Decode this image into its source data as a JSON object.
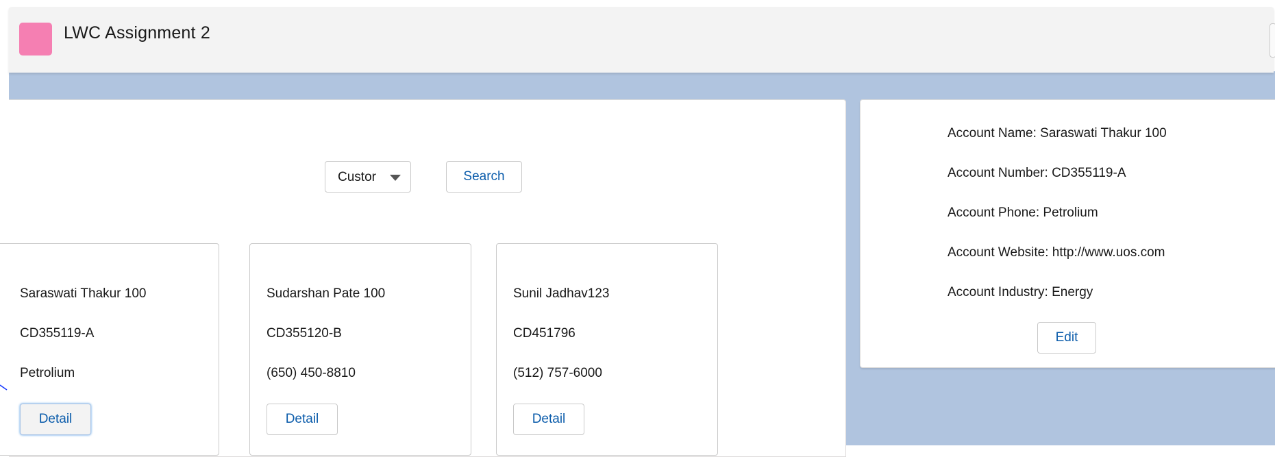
{
  "app": {
    "title": "LWC Assignment 2",
    "icon_name": "app-icon",
    "icon_color": "#f57fb2"
  },
  "search": {
    "picklist_value": "Custor",
    "search_label": "Search"
  },
  "accounts": [
    {
      "name": "Saraswati Thakur 100",
      "number": "CD355119-A",
      "phone": "Petrolium",
      "detail_label": "Detail"
    },
    {
      "name": "Sudarshan Pate 100",
      "number": "CD355120-B",
      "phone": "(650) 450-8810",
      "detail_label": "Detail"
    },
    {
      "name": "Sunil Jadhav123",
      "number": "CD451796",
      "phone": "(512) 757-6000",
      "detail_label": "Detail"
    }
  ],
  "detail": {
    "name": "Account Name: Saraswati Thakur 100",
    "number": "Account Number: CD355119-A",
    "phone": "Account Phone: Petrolium",
    "website": "Account Website: http://www.uos.com",
    "industry": "Account Industry: Energy",
    "edit_label": "Edit"
  },
  "colors": {
    "accent": "#0b5cab",
    "background_band": "#b0c4df",
    "header_bg": "#f3f3f3"
  }
}
